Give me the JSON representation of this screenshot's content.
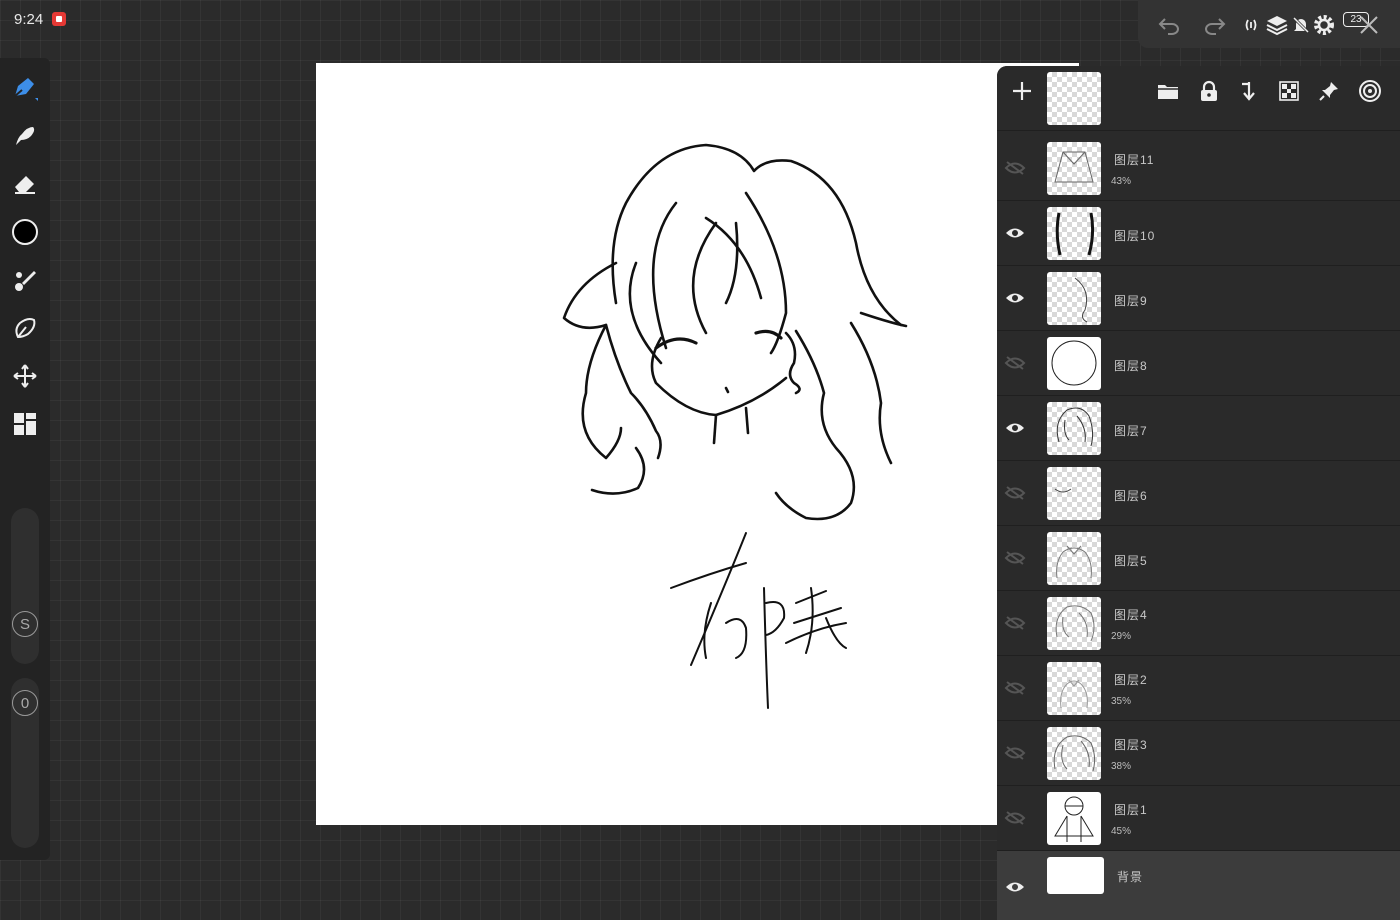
{
  "status": {
    "time": "9:24",
    "battery": "23"
  },
  "top_controls": {
    "undo_icon": "undo-icon",
    "redo_icon": "redo-icon",
    "close_icon": "close-icon"
  },
  "left_toolbar": {
    "tools": [
      "brush-pen-icon",
      "smudge-icon",
      "eraser-icon",
      "color-swatch",
      "brush-library-icon",
      "lasso-selection-icon",
      "transform-move-icon",
      "gallery-grid-icon"
    ],
    "active_color": "#000000",
    "size_slider_label": "S",
    "opacity_slider_label": "0"
  },
  "layers_panel": {
    "header_icons": [
      "add-layer-icon",
      "folder-icon",
      "lock-icon",
      "merge-down-icon",
      "transparency-lock-icon",
      "pin-icon",
      "layer-menu-icon"
    ],
    "layers": [
      {
        "name": "图层11",
        "opacity": "43%",
        "visible": false
      },
      {
        "name": "图层10",
        "opacity": "",
        "visible": true
      },
      {
        "name": "图层9",
        "opacity": "",
        "visible": true
      },
      {
        "name": "图层8",
        "opacity": "",
        "visible": false
      },
      {
        "name": "图层7",
        "opacity": "",
        "visible": true
      },
      {
        "name": "图层6",
        "opacity": "",
        "visible": false
      },
      {
        "name": "图层5",
        "opacity": "",
        "visible": false
      },
      {
        "name": "图层4",
        "opacity": "29%",
        "visible": false
      },
      {
        "name": "图层2",
        "opacity": "35%",
        "visible": false
      },
      {
        "name": "图层3",
        "opacity": "38%",
        "visible": false
      },
      {
        "name": "图层1",
        "opacity": "45%",
        "visible": false
      },
      {
        "name": "背景",
        "opacity": "",
        "visible": true,
        "selected": true
      }
    ]
  },
  "colors": {
    "accent": "#3d8ee8",
    "panel": "#2a2a2a",
    "selected_row": "#3c3c3c"
  }
}
